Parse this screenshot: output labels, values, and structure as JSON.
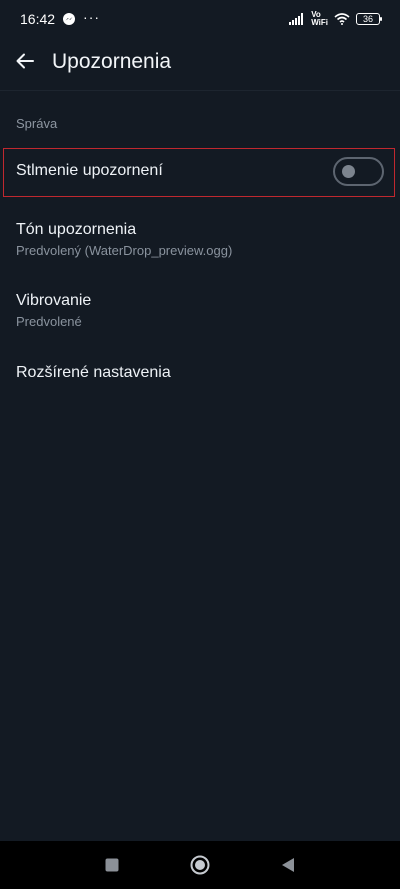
{
  "status_bar": {
    "time": "16:42",
    "notification_icons": [
      "messenger-icon",
      "more-notifications-icon"
    ],
    "volte_line1": "Vo",
    "volte_line2": "WiFi",
    "battery": "36"
  },
  "app_bar": {
    "title": "Upozornenia",
    "back_icon": "arrow-back-icon"
  },
  "section": {
    "header": "Správa"
  },
  "settings": {
    "mute": {
      "title": "Stlmenie upozornení",
      "toggle_on": false
    },
    "tone": {
      "title": "Tón upozornenia",
      "subtitle": "Predvolený (WaterDrop_preview.ogg)"
    },
    "vibration": {
      "title": "Vibrovanie",
      "subtitle": "Predvolené"
    },
    "advanced": {
      "title": "Rozšírené nastavenia"
    }
  },
  "nav_bar": {
    "buttons": [
      "recents-square-icon",
      "home-circle-icon",
      "back-triangle-icon"
    ]
  },
  "colors": {
    "background": "#131a23",
    "highlight_border": "#c0282f",
    "secondary_text": "#8a939e"
  }
}
